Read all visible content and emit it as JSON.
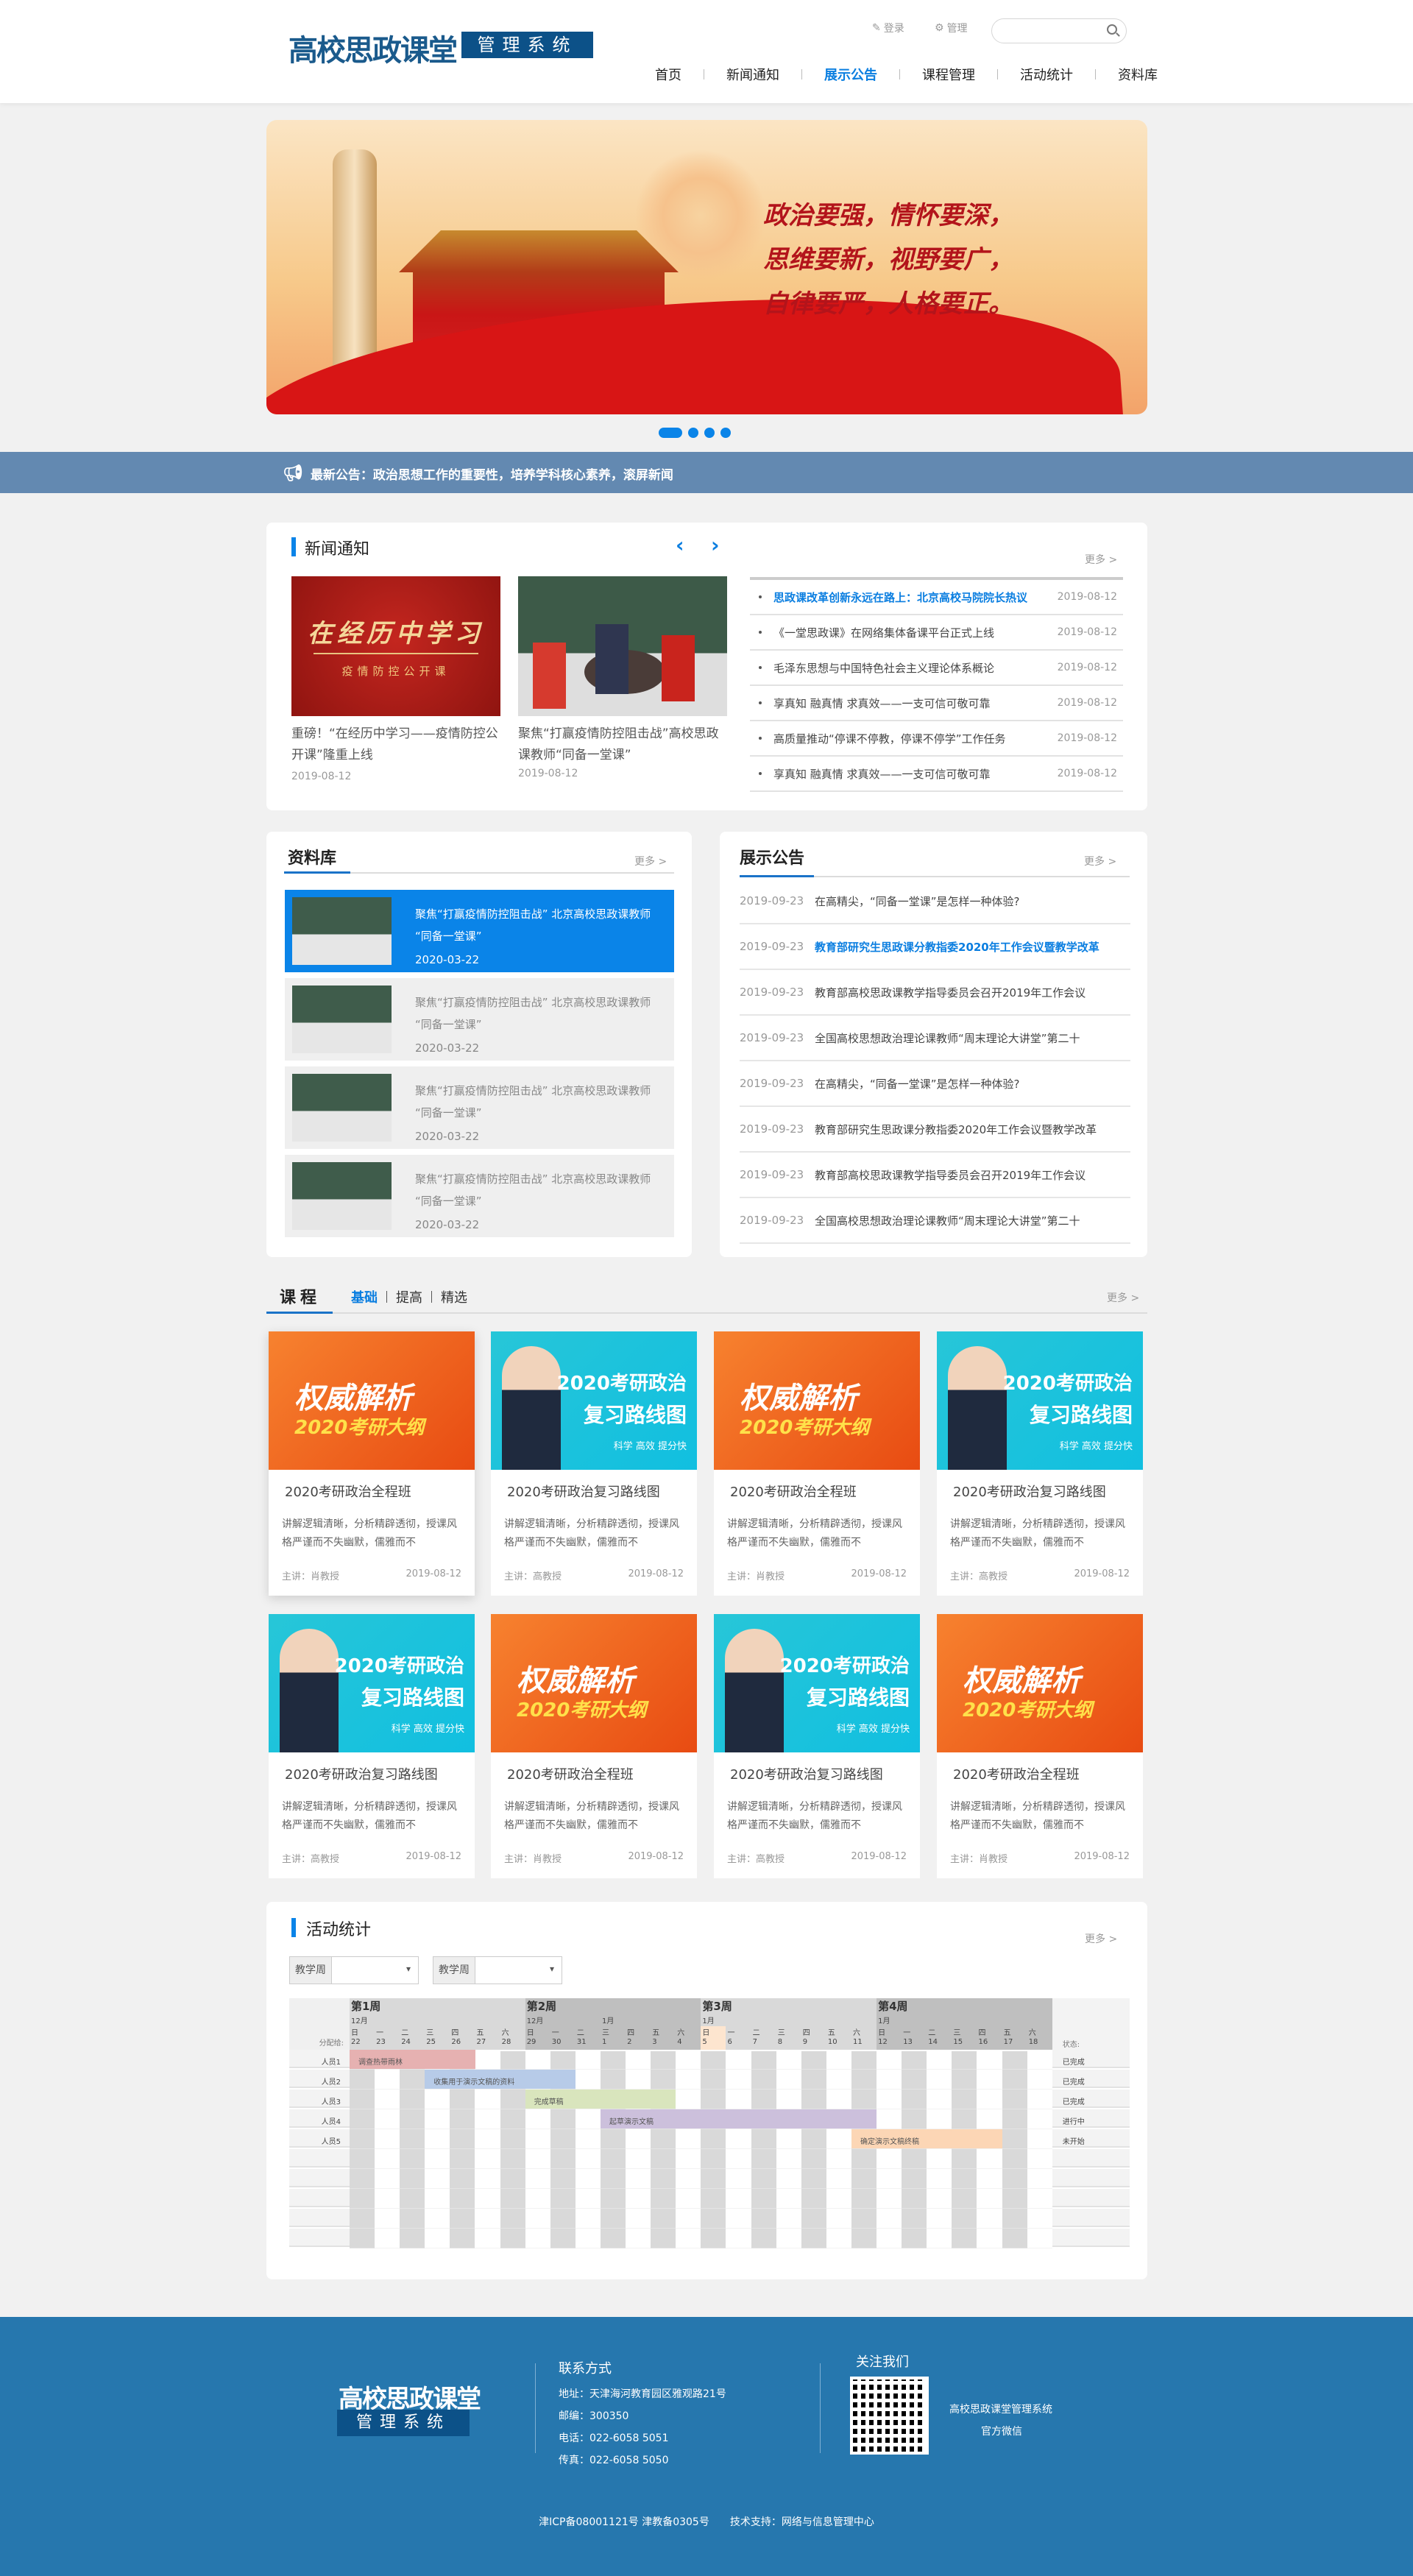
{
  "header": {
    "logo_main": "高校思政课堂",
    "logo_sub": "管理系统",
    "login": "登录",
    "manage": "管理",
    "search_value": "",
    "nav": [
      "首页",
      "新闻通知",
      "展示公告",
      "课程管理",
      "活动统计",
      "资料库"
    ],
    "nav_active": 2
  },
  "banner": {
    "slogans": [
      "政治要强，情怀要深，",
      "思维要新，视野要广，",
      "自律要严，人格要正。"
    ],
    "slides": 4,
    "active_slide": 0
  },
  "announcement": "最新公告：政治思想工作的重要性，培养学科核心素养，滚屏新闻",
  "news": {
    "title": "新闻通知",
    "more": "更多 >",
    "prev": "‹",
    "next": "›",
    "featured": [
      {
        "image_title": "在经历中学习",
        "image_sub": "疫情防控公开课",
        "caption": "重磅！“在经历中学习——疫情防控公开课”隆重上线",
        "date": "2019-08-12"
      },
      {
        "image_title": "",
        "image_sub": "",
        "caption": "聚焦“打赢疫情防控阻击战”高校思政课教师“同备一堂课”",
        "date": "2019-08-12"
      }
    ],
    "list": [
      {
        "title": "思政课改革创新永远在路上：北京高校马院院长热议",
        "date": "2019-08-12",
        "highlight": true
      },
      {
        "title": "《一堂思政课》在网络集体备课平台正式上线",
        "date": "2019-08-12"
      },
      {
        "title": "毛泽东思想与中国特色社会主义理论体系概论",
        "date": "2019-08-12"
      },
      {
        "title": "享真知 融真情 求真效——一支可信可敬可靠",
        "date": "2019-08-12"
      },
      {
        "title": "高质量推动“停课不停教，停课不停学”工作任务",
        "date": "2019-08-12"
      },
      {
        "title": "享真知 融真情 求真效——一支可信可敬可靠",
        "date": "2019-08-12"
      }
    ]
  },
  "library": {
    "title": "资料库",
    "more": "更多 >",
    "items": [
      {
        "title": "聚焦“打赢疫情防控阻击战” 北京高校思政课教师 “同备一堂课”",
        "date": "2020-03-22",
        "highlight": true
      },
      {
        "title": "聚焦“打赢疫情防控阻击战” 北京高校思政课教师 “同备一堂课”",
        "date": "2020-03-22"
      },
      {
        "title": "聚焦“打赢疫情防控阻击战” 北京高校思政课教师 “同备一堂课”",
        "date": "2020-03-22"
      },
      {
        "title": "聚焦“打赢疫情防控阻击战” 北京高校思政课教师 “同备一堂课”",
        "date": "2020-03-22"
      }
    ]
  },
  "notices": {
    "title": "展示公告",
    "more": "更多 >",
    "items": [
      {
        "date": "2019-09-23",
        "title": "在高精尖，“同备一堂课”是怎样一种体验?"
      },
      {
        "date": "2019-09-23",
        "title": "教育部研究生思政课分教指委2020年工作会议暨教学改革",
        "highlight": true
      },
      {
        "date": "2019-09-23",
        "title": "教育部高校思政课教学指导委员会召开2019年工作会议"
      },
      {
        "date": "2019-09-23",
        "title": "全国高校思想政治理论课教师“周末理论大讲堂”第二十"
      },
      {
        "date": "2019-09-23",
        "title": "在高精尖，“同备一堂课”是怎样一种体验?"
      },
      {
        "date": "2019-09-23",
        "title": "教育部研究生思政课分教指委2020年工作会议暨教学改革"
      },
      {
        "date": "2019-09-23",
        "title": "教育部高校思政课教学指导委员会召开2019年工作会议"
      },
      {
        "date": "2019-09-23",
        "title": "全国高校思想政治理论课教师“周末理论大讲堂”第二十"
      }
    ]
  },
  "courses": {
    "title": "课程",
    "tabs": [
      "基础",
      "提高",
      "精选"
    ],
    "active_tab": 0,
    "more": "更多 >",
    "image_texts": {
      "a": [
        "权威解析",
        "2020考研大纲"
      ],
      "b": [
        "2020考研政治",
        "复习路线图",
        "科学 高效 提分快"
      ]
    },
    "cards": [
      {
        "type": "a",
        "title": "2020考研政治全程班",
        "desc": "讲解逻辑清晰，分析精辟透彻，授课风格严谨而不失幽默，儒雅而不",
        "lecturer": "主讲：肖教授",
        "date": "2019-08-12"
      },
      {
        "type": "b",
        "title": "2020考研政治复习路线图",
        "desc": "讲解逻辑清晰，分析精辟透彻，授课风格严谨而不失幽默，儒雅而不",
        "lecturer": "主讲：高教授",
        "date": "2019-08-12"
      },
      {
        "type": "a",
        "title": "2020考研政治全程班",
        "desc": "讲解逻辑清晰，分析精辟透彻，授课风格严谨而不失幽默，儒雅而不",
        "lecturer": "主讲：肖教授",
        "date": "2019-08-12"
      },
      {
        "type": "b",
        "title": "2020考研政治复习路线图",
        "desc": "讲解逻辑清晰，分析精辟透彻，授课风格严谨而不失幽默，儒雅而不",
        "lecturer": "主讲：高教授",
        "date": "2019-08-12"
      },
      {
        "type": "b",
        "title": "2020考研政治复习路线图",
        "desc": "讲解逻辑清晰，分析精辟透彻，授课风格严谨而不失幽默，儒雅而不",
        "lecturer": "主讲：高教授",
        "date": "2019-08-12"
      },
      {
        "type": "a",
        "title": "2020考研政治全程班",
        "desc": "讲解逻辑清晰，分析精辟透彻，授课风格严谨而不失幽默，儒雅而不",
        "lecturer": "主讲：肖教授",
        "date": "2019-08-12"
      },
      {
        "type": "b",
        "title": "2020考研政治复习路线图",
        "desc": "讲解逻辑清晰，分析精辟透彻，授课风格严谨而不失幽默，儒雅而不",
        "lecturer": "主讲：高教授",
        "date": "2019-08-12"
      },
      {
        "type": "a",
        "title": "2020考研政治全程班",
        "desc": "讲解逻辑清晰，分析精辟透彻，授课风格严谨而不失幽默，儒雅而不",
        "lecturer": "主讲：肖教授",
        "date": "2019-08-12"
      }
    ]
  },
  "activity": {
    "title": "活动统计",
    "more": "更多 >",
    "selects": [
      {
        "label": "教学周",
        "value": ""
      },
      {
        "label": "教学周",
        "value": ""
      }
    ],
    "gantt": {
      "assignee_header": "分配给:",
      "status_header": "状态:",
      "weeks": [
        "第1周",
        "第2周",
        "第3周",
        "第4周"
      ],
      "months": [
        {
          "day": 0,
          "label": "12月"
        },
        {
          "day": 7,
          "label": "12月"
        },
        {
          "day": 10,
          "label": "1月"
        },
        {
          "day": 14,
          "label": "1月"
        },
        {
          "day": 21,
          "label": "1月"
        }
      ],
      "weekdays": [
        "日",
        "一",
        "二",
        "三",
        "四",
        "五",
        "六"
      ],
      "dates": [
        "22",
        "23",
        "24",
        "25",
        "26",
        "27",
        "28",
        "29",
        "30",
        "31",
        "1",
        "2",
        "3",
        "4",
        "5",
        "6",
        "7",
        "8",
        "9",
        "10",
        "11",
        "12",
        "13",
        "14",
        "15",
        "16",
        "17",
        "18"
      ],
      "highlight_day": 14,
      "people": [
        "人员1",
        "人员2",
        "人员3",
        "人员4",
        "人员5"
      ],
      "statuses": [
        "已完成",
        "已完成",
        "已完成",
        "进行中",
        "未开始"
      ],
      "tasks": [
        {
          "row": 0,
          "start": 0,
          "end": 5,
          "label": "调查热带雨林",
          "color": "#e6b1b1"
        },
        {
          "row": 1,
          "start": 3,
          "end": 9,
          "label": "收集用于演示文稿的资料",
          "color": "#b7cbe8"
        },
        {
          "row": 2,
          "start": 7,
          "end": 13,
          "label": "完成草稿",
          "color": "#d9e5bd"
        },
        {
          "row": 3,
          "start": 10,
          "end": 21,
          "label": "起草演示文稿",
          "color": "#ccc0dc"
        },
        {
          "row": 4,
          "start": 20,
          "end": 26,
          "label": "确定演示文稿终稿",
          "color": "#fcd6b5"
        }
      ],
      "empty_rows": 5
    }
  },
  "footer": {
    "logo_main": "高校思政课堂",
    "logo_sub": "管理系统",
    "contact_title": "联系方式",
    "contact": [
      "地址：天津海河教育园区雅观路21号",
      "邮编：300350",
      "电话：022-6058 5051",
      "传真：022-6058 5050"
    ],
    "follow_title": "关注我们",
    "wechat_name": "高校思政课堂管理系统",
    "wechat_label": "官方微信",
    "copyright": "津ICP备08001121号 津教备0305号　　技术支持：网络与信息管理中心"
  }
}
